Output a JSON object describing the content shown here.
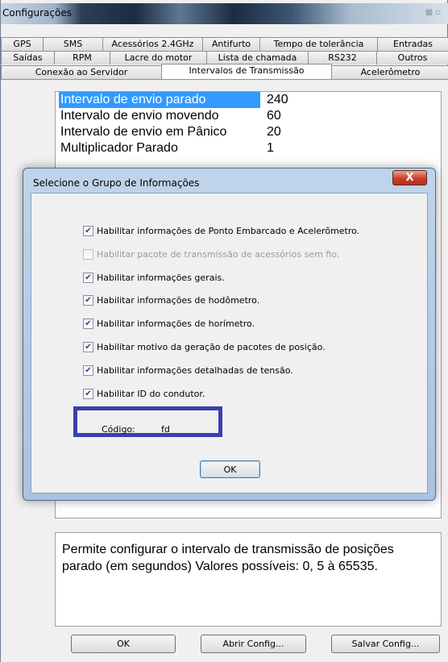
{
  "window": {
    "title": "Configurações"
  },
  "tabs": {
    "row1": [
      "GPS",
      "SMS",
      "Acessórios 2.4GHz",
      "Antifurto",
      "Tempo de tolerância",
      "Entradas"
    ],
    "row2": [
      "Saídas",
      "RPM",
      "Lacre do motor",
      "Lista de chamada",
      "RS232",
      "Outros"
    ],
    "row3": [
      "Conexão ao Servidor",
      "Intervalos de Transmissão",
      "Acelerômetro"
    ],
    "active": "Intervalos de Transmissão"
  },
  "properties": [
    {
      "name": "Intervalo de envio parado",
      "value": "240",
      "selected": true
    },
    {
      "name": "Intervalo de envio movendo",
      "value": "60"
    },
    {
      "name": "Intervalo de envio em Pânico",
      "value": "20"
    },
    {
      "name": "Multiplicador Parado",
      "value": "1"
    }
  ],
  "description": "Permite configurar o intervalo de transmissão de posições parado (em segundos) Valores possíveis: 0, 5 à 65535.",
  "buttons": {
    "ok": "OK",
    "open": "Abrir Config...",
    "save": "Salvar Config..."
  },
  "dialog": {
    "title": "Selecione o Grupo de Informações",
    "close": "X",
    "options": [
      {
        "label": "Habilitar informações de Ponto Embarcado e Acelerômetro.",
        "checked": true,
        "enabled": true
      },
      {
        "label": "Habilitar pacote de transmissão de acessórios sem fio.",
        "checked": false,
        "enabled": false
      },
      {
        "label": "Habilitar informações gerais.",
        "checked": true,
        "enabled": true
      },
      {
        "label": "Habilitar informações de hodômetro.",
        "checked": true,
        "enabled": true
      },
      {
        "label": "Habilitar informações de horímetro.",
        "checked": true,
        "enabled": true
      },
      {
        "label": "Habilitar motivo da geração de pacotes de posição.",
        "checked": true,
        "enabled": true
      },
      {
        "label": "Habilitar informações detalhadas de tensão.",
        "checked": true,
        "enabled": true
      },
      {
        "label": "Habilitar ID do condutor.",
        "checked": true,
        "enabled": true
      }
    ],
    "code_label": "Código:",
    "code_value": "fd",
    "ok": "OK"
  },
  "colors": {
    "selection": "#3399ff",
    "highlight_frame": "#3c3fae",
    "dialog_frame": "#a9c3df"
  }
}
